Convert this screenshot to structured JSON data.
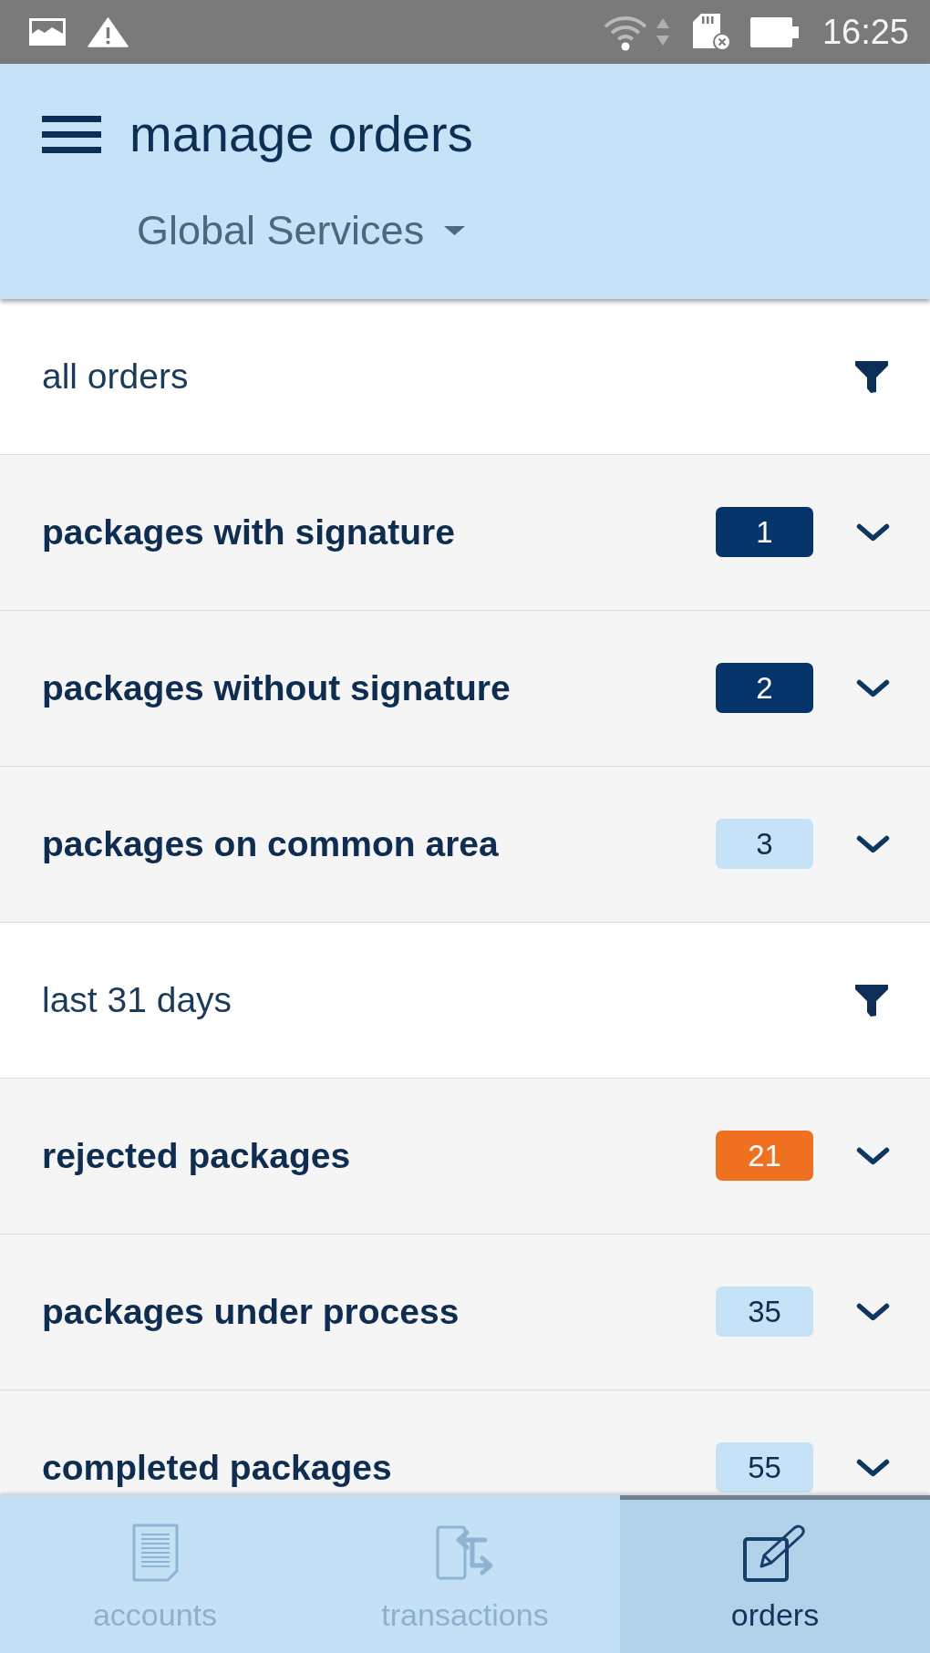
{
  "status_bar": {
    "time": "16:25"
  },
  "header": {
    "title": "manage orders",
    "account": "Global Services"
  },
  "sections": [
    {
      "title": "all orders",
      "rows": [
        {
          "label": "packages with signature",
          "count": "1",
          "color": "#05346a"
        },
        {
          "label": "packages without signature",
          "count": "2",
          "color": "#05346a"
        },
        {
          "label": "packages on common area",
          "count": "3",
          "color": "#c5e2f6"
        }
      ]
    },
    {
      "title": "last 31 days",
      "rows": [
        {
          "label": "rejected packages",
          "count": "21",
          "color": "#f07022"
        },
        {
          "label": "packages under process",
          "count": "35",
          "color": "#c5e2f6"
        },
        {
          "label": "completed packages",
          "count": "55",
          "color": "#c5e2f6"
        }
      ]
    }
  ],
  "tab_bar": {
    "tabs": [
      {
        "label": "accounts",
        "selected": false
      },
      {
        "label": "transactions",
        "selected": false
      },
      {
        "label": "orders",
        "selected": true
      }
    ]
  }
}
